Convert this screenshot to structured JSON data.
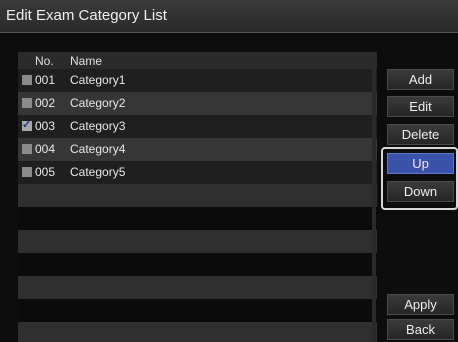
{
  "window": {
    "title": "Edit Exam Category List"
  },
  "list": {
    "headers": {
      "no": "No.",
      "name": "Name"
    },
    "rows": [
      {
        "no": "001",
        "name": "Category1",
        "checked": false
      },
      {
        "no": "002",
        "name": "Category2",
        "checked": false
      },
      {
        "no": "003",
        "name": "Category3",
        "checked": true
      },
      {
        "no": "004",
        "name": "Category4",
        "checked": false
      },
      {
        "no": "005",
        "name": "Category5",
        "checked": false
      }
    ]
  },
  "buttons": {
    "add": "Add",
    "edit": "Edit",
    "delete": "Delete",
    "up": "Up",
    "down": "Down",
    "apply": "Apply",
    "back": "Back"
  },
  "colors": {
    "selected_button": "#3a52a8",
    "checkbox_tick": "#1e3f9a"
  },
  "icons": {
    "checked": "check-icon"
  }
}
